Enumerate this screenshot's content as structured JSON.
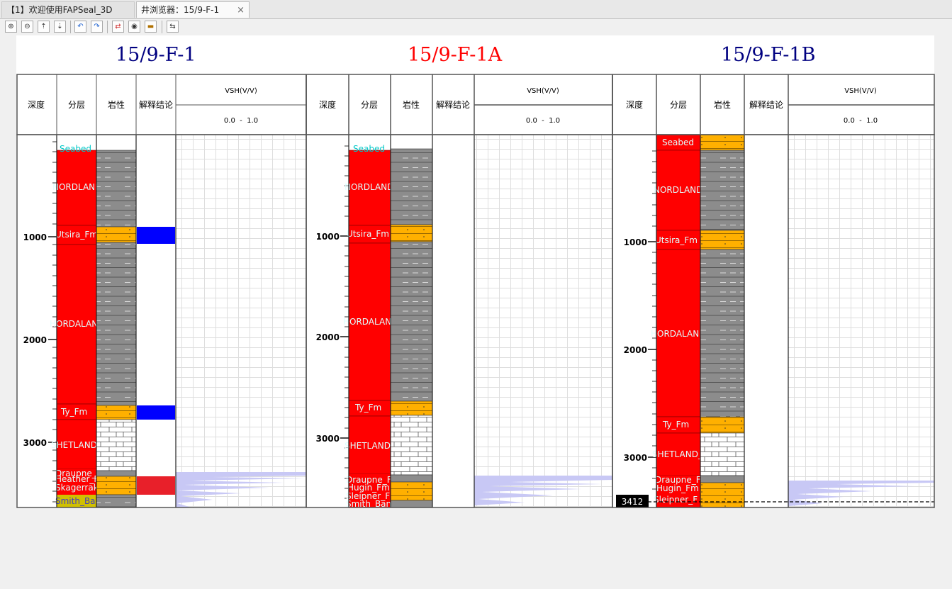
{
  "tabs": [
    {
      "label": "【1】欢迎使用FAPSeal_3D"
    },
    {
      "label": "井浏览器：15/9-F-1",
      "close": "×"
    }
  ],
  "toolbar": {
    "buttons": [
      "zoom-in-icon",
      "zoom-out-icon",
      "zoom-vertical-in-icon",
      "zoom-vertical-out-icon",
      "undo-icon",
      "redo-icon",
      "connect-icon",
      "eye-icon",
      "flag-icon",
      "swap-icon"
    ]
  },
  "colors": {
    "formation_red": "#ff0000",
    "sand_orange": "#ffb000",
    "shale_gray": "#8c8c8c",
    "interp_blue": "#0000ff",
    "interp_red": "#e8202a",
    "curve_fill": "#c8c8f5",
    "formation_label": "#e0ffff",
    "well1_title": "#000080",
    "well2_title": "#ff0000",
    "well3_title": "#000080"
  },
  "columns": {
    "depth": "深度",
    "formation": "分层",
    "lithology": "岩性",
    "interpretation": "解释结论",
    "curve_name": "VSH(V/V)",
    "curve_range": "0.0  -  1.0"
  },
  "wells": [
    {
      "name": "15/9-F-1",
      "depth_ticks": [
        "1000",
        "2000",
        "3000"
      ],
      "formations": [
        "Seabed",
        "NORDLAND_",
        "Utsira_Fm",
        "HORDALAND_",
        "Ty_Fm",
        "SHETLAND_",
        "Draupne_Fm",
        "Heather_Fm",
        "Skagerrak_",
        "Smith_Bank"
      ],
      "interpretation": [
        "reservoir",
        "reservoir",
        "unknown"
      ]
    },
    {
      "name": "15/9-F-1A",
      "depth_ticks": [
        "1000",
        "2000",
        "3000"
      ],
      "formations": [
        "Seabed",
        "NORDLAND_",
        "Utsira_Fm",
        "HORDALAND_",
        "Ty_Fm",
        "SHETLAND_",
        "Draupne_F",
        "Hugin_Fm",
        "Sleipner_F",
        "Smith_Bank"
      ]
    },
    {
      "name": "15/9-F-1B",
      "depth_ticks": [
        "1000",
        "2000",
        "3000"
      ],
      "formations": [
        "Seabed",
        "NORDLAND_G",
        "Utsira_Fm",
        "HORDALAND_",
        "Ty_Fm",
        "SHETLAND_G",
        "Draupne_F",
        "Hugin_Fm",
        "Sleipner_F"
      ],
      "cursor_depth": "3412"
    }
  ]
}
